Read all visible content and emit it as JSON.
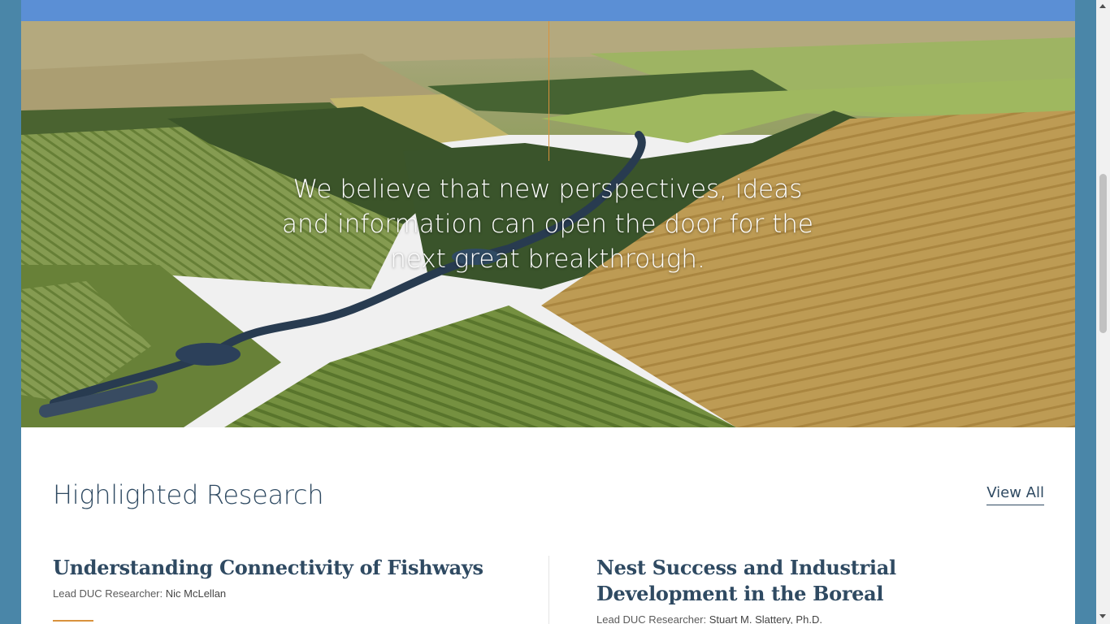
{
  "hero": {
    "quote": "We believe that new perspectives, ideas and information can open the door for the next great breakthrough."
  },
  "research": {
    "heading": "Highlighted Research",
    "view_all": "View All",
    "cards": [
      {
        "title": "Understanding Connectivity of Fishways",
        "lead_label": "Lead DUC Researcher:",
        "lead_name": "Nic McLellan"
      },
      {
        "title": "Nest Success and Industrial Development in the Boreal",
        "lead_label": "Lead DUC Researcher:",
        "lead_name": "Stuart M. Slattery, Ph.D."
      }
    ]
  },
  "colors": {
    "page_background": "#4a86a8",
    "top_band": "#5b8fd5",
    "heading_text": "#2f4a62",
    "accent_orange": "#d9923d"
  }
}
